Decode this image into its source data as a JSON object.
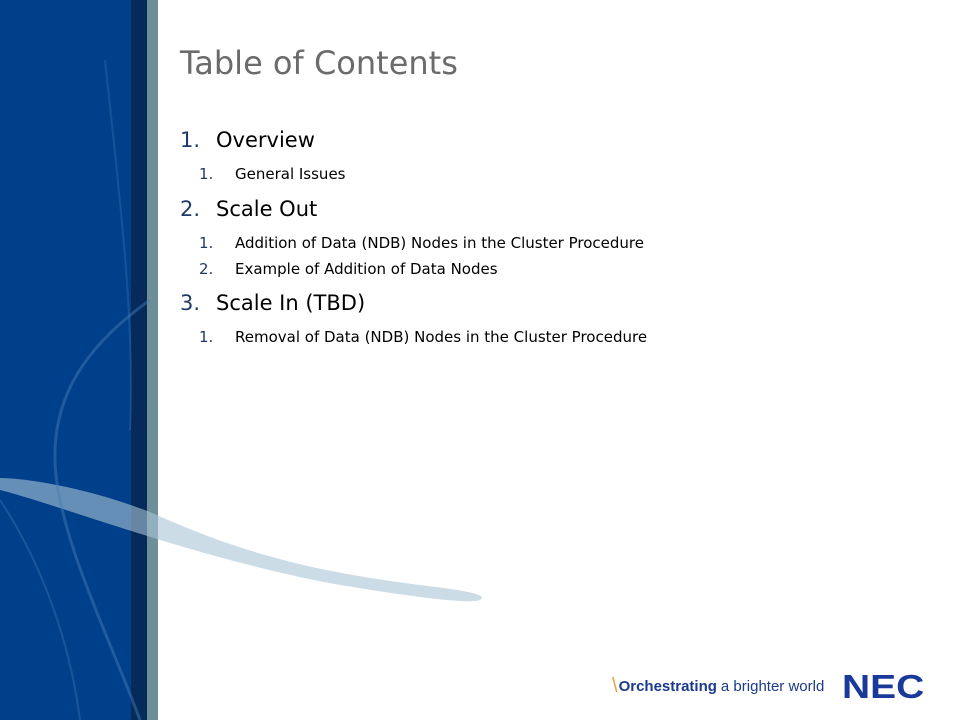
{
  "slide": {
    "title": "Table of Contents",
    "sections": [
      {
        "number": "1.",
        "label": "Overview",
        "subitems": [
          {
            "number": "1.",
            "label": "General Issues"
          }
        ]
      },
      {
        "number": "2.",
        "label": "Scale Out",
        "subitems": [
          {
            "number": "1.",
            "label": "Addition of Data (NDB) Nodes in the Cluster Procedure"
          },
          {
            "number": "2.",
            "label": "Example of Addition of Data Nodes"
          }
        ]
      },
      {
        "number": "3.",
        "label": "Scale In (TBD)",
        "subitems": [
          {
            "number": "1.",
            "label": "Removal of Data (NDB) Nodes  in the Cluster Procedure"
          }
        ]
      }
    ]
  },
  "footer": {
    "tagline_slash": "\\",
    "tagline_strong": "Orchestrating",
    "tagline_soft": "a brighter world",
    "logo": "NEC"
  },
  "colors": {
    "sidebar_blue": "#003f8a",
    "dark_stripe": "#062a5a",
    "gray_stripe": "#6e8f9a",
    "title_gray": "#6b6b6b",
    "number_blue": "#1f3a66",
    "brand_blue": "#1a3a9a",
    "accent_orange": "#e8a23a"
  }
}
